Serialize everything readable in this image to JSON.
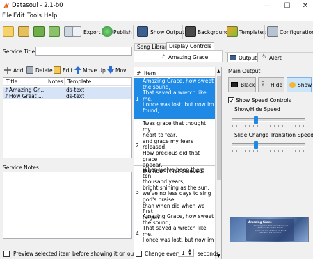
{
  "window": {
    "title": "Datasoul - 2.1-b0",
    "minimize_glyph": "—",
    "maximize_glyph": "☐",
    "close_glyph": "✕"
  },
  "menu": [
    "File",
    "Edit",
    "Tools",
    "Help"
  ],
  "toolbar": {
    "export": "Export",
    "publish": "Publish",
    "show_output": "Show Output",
    "background": "Background",
    "templates": "Templates",
    "configuration": "Configuration"
  },
  "service": {
    "title_label": "Service Title:",
    "title_value": "",
    "add": "Add",
    "delete": "Delete",
    "edit": "Edit",
    "move_up": "Move Up",
    "move_down": "Mov",
    "columns": [
      "Title",
      "Notes",
      "Template"
    ],
    "rows": [
      {
        "title": "Amazing Gr...",
        "notes": "",
        "template": "ds-text"
      },
      {
        "title": "How Great ...",
        "notes": "",
        "template": "ds-text"
      }
    ],
    "notes_label": "Service Notes:",
    "notes_value": "",
    "preview_checkbox": "Preview selected item before showing it on outputs"
  },
  "middle": {
    "tabs": [
      "Song Library",
      "Display Controls"
    ],
    "active_tab": "Display Controls",
    "song_title": "Amazing Grace",
    "columns": [
      "#",
      "Item"
    ],
    "verses": [
      {
        "num": "1",
        "text": "Amazing Grace, how sweet\nthe sound,\nThat saved a wretch like\nme.\nI once was lost, but now im\nfound,"
      },
      {
        "num": "2",
        "text": "Twas grace that thought my\nheart to fear,\nand grace my fears\nreleased.\nHow precious did that grace\nappear,\nthe  hour I first beleved."
      },
      {
        "num": "3",
        "text": "When we've been there ten\nthousand years,\nbright shining as the sun,\nwe've no less days to sing\ngod's praise\nthan when did when we first\nbegun."
      },
      {
        "num": "4",
        "text": "Amazing Grace, how sweet\nthe sound,\nThat saved a wretch like\nme.\nI once was lost, but now im"
      }
    ],
    "change_every_label": "Change every",
    "change_every_value": "1",
    "seconds_label": "seconds"
  },
  "right": {
    "tabs": [
      "Output",
      "Alert"
    ],
    "main_output_label": "Main Output",
    "black": "Black",
    "hide": "Hide",
    "show": "Show",
    "show_speed_controls": "Show Speed Controls",
    "show_hide_speed": "Show/Hide Speed",
    "show_hide_speed_value": 0.33,
    "slide_change_speed": "Slide Change Transition Speed",
    "slide_change_speed_value": 0.33,
    "preview_title": "Amazing Grace",
    "preview_text": "Amazing Grace, how sweet the sound\nThat saved a wretch like me\nI once was lost, but now am found\nWas blind but now I see"
  },
  "colors": {
    "selection": "#1e8ae6",
    "row_highlight": "#d7e4f7"
  }
}
